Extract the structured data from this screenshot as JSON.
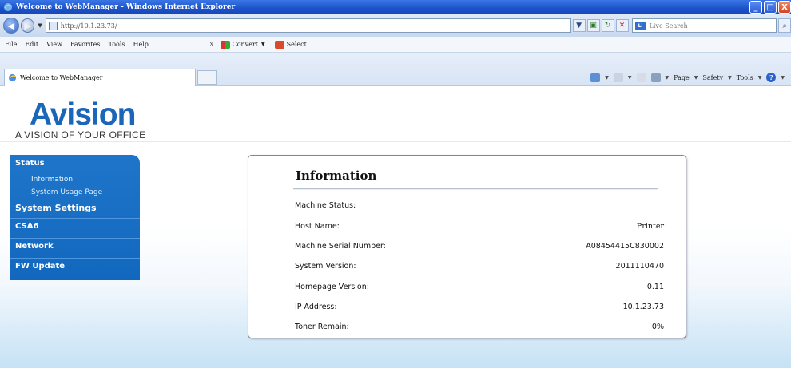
{
  "window": {
    "title": "Welcome to WebManager - Windows Internet Explorer",
    "controls": {
      "minimize": "_",
      "maximize": "□",
      "close": "X"
    }
  },
  "address_bar": {
    "url": "http://10.1.23.73/",
    "search_placeholder": "Live Search"
  },
  "menu": {
    "items": [
      "File",
      "Edit",
      "View",
      "Favorites",
      "Tools",
      "Help"
    ],
    "close_x": "X",
    "convert": "Convert",
    "select": "Select"
  },
  "tab": {
    "title": "Welcome to WebManager"
  },
  "command_bar": {
    "page": "Page",
    "safety": "Safety",
    "tools": "Tools"
  },
  "logo": {
    "word": "Avision",
    "tagline": "A VISION OF YOUR OFFICE"
  },
  "sidebar": {
    "status": "Status",
    "information": "Information",
    "system_usage": "System Usage Page",
    "system_settings": "System Settings",
    "csa6": "CSA6",
    "network": "Network",
    "fw_update": "FW Update"
  },
  "info": {
    "title": "Information",
    "rows": [
      {
        "label": "Machine Status:",
        "value": ""
      },
      {
        "label": "Host Name:",
        "value": "Printer"
      },
      {
        "label": "Machine Serial Number:",
        "value": "A08454415C830002"
      },
      {
        "label": "System Version:",
        "value": "2011110470"
      },
      {
        "label": "Homepage Version:",
        "value": "0.11"
      },
      {
        "label": "IP Address:",
        "value": "10.1.23.73"
      },
      {
        "label": "Toner Remain:",
        "value": "0%"
      }
    ]
  },
  "colors": {
    "sidebar_blue": "#1f75c9",
    "logo_blue": "#1a66b8",
    "titlebar_blue": "#1b52c9"
  }
}
